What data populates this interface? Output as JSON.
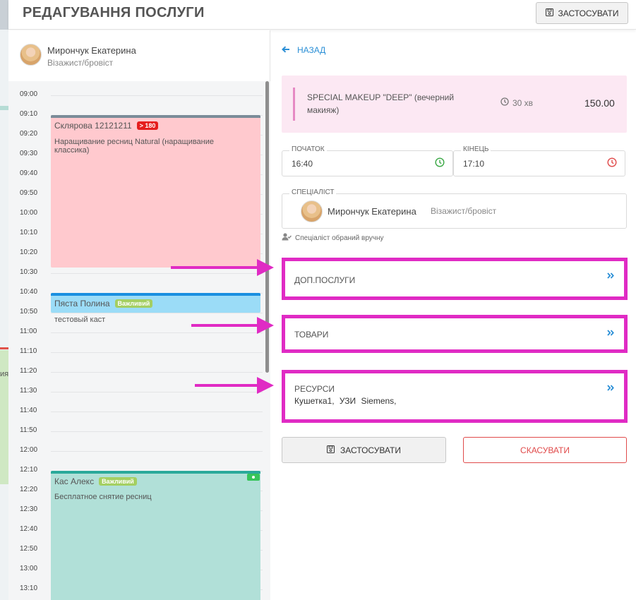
{
  "header": {
    "title": "РЕДАГУВАННЯ ПОСЛУГИ",
    "apply_label": "ЗАСТОСУВАТИ"
  },
  "background": {
    "partial_text": "ия"
  },
  "specialist": {
    "name": "Мирончук Екатерина",
    "role": "Візажист/бровіст"
  },
  "timeline": {
    "times": [
      "09:00",
      "09:10",
      "09:20",
      "09:30",
      "09:40",
      "09:50",
      "10:00",
      "10:10",
      "10:20",
      "10:30",
      "10:40",
      "10:50",
      "11:00",
      "11:10",
      "11:20",
      "11:30",
      "11:40",
      "11:50",
      "12:00",
      "12:10",
      "12:20",
      "12:30",
      "12:40",
      "12:50",
      "13:00",
      "13:10"
    ],
    "appointments": [
      {
        "client": "Склярова 12121211",
        "badge": "> 180",
        "service": "Наращивание ресниц Natural (наращивание классика)",
        "color": "#ffc9ce",
        "border": "#7b8c99"
      },
      {
        "client": "Пяста Полина",
        "badge": "Важливий",
        "service": "тестовый каст",
        "color": "#9bdcf7",
        "border": "#1a8fe0"
      },
      {
        "client": "Кас Алекс",
        "badge": "Важливий",
        "service": "Бесплатное снятие ресниц",
        "color": "#b1e0d8",
        "border": "#2aa99a"
      }
    ]
  },
  "back_label": "НАЗАД",
  "service": {
    "name": "SPECIAL MAKEUP \"DEEP\" (вечерний макияж)",
    "duration": "30 хв",
    "price": "150.00"
  },
  "start": {
    "label": "ПОЧАТОК",
    "value": "16:40"
  },
  "end": {
    "label": "КІНЕЦЬ",
    "value": "17:10"
  },
  "specialist_field": {
    "label": "СПЕЦІАЛІСТ",
    "name": "Мирончук Екатерина",
    "role": "Візажист/бровіст"
  },
  "manual_note": "Спеціаліст обраний вручну",
  "sections": {
    "extra_services": {
      "title": "ДОП.ПОСЛУГИ"
    },
    "goods": {
      "title": "ТОВАРИ"
    },
    "resources": {
      "title": "РЕСУРСИ",
      "items": "Кушетка1, УЗИ Siemens,"
    }
  },
  "actions": {
    "apply": "ЗАСТОСУВАТИ",
    "cancel": "СКАСУВАТИ"
  },
  "colors": {
    "accent": "#2b8fd6",
    "highlight": "#e02bc4",
    "cancel": "#e04a4a",
    "service_bg": "#fce8f3"
  }
}
